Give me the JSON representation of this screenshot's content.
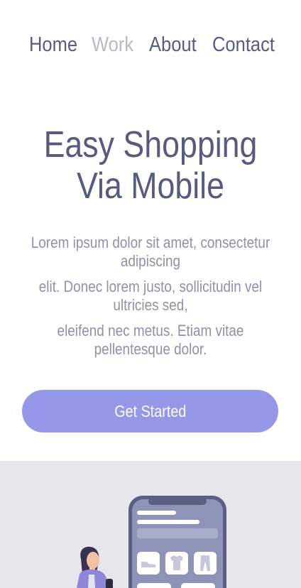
{
  "nav": {
    "items": [
      {
        "label": "Home",
        "active": false
      },
      {
        "label": "Work",
        "active": true
      },
      {
        "label": "About",
        "active": false
      },
      {
        "label": "Contact",
        "active": false
      }
    ]
  },
  "hero": {
    "title_line1": "Easy Shopping",
    "title_line2": "Via Mobile",
    "description_lines": [
      "Lorem ipsum dolor sit amet, consectetur adipiscing",
      "elit. Donec lorem justo, sollicitudin vel ultricies sed,",
      "eleifend nec metus. Etiam vitae pellentesque dolor."
    ],
    "cta_label": "Get Started"
  },
  "illustration": {
    "phone_icons": [
      "shoe-icon",
      "tshirt-icon",
      "pants-icon"
    ]
  },
  "colors": {
    "nav_text": "#585c7e",
    "nav_active": "#b7b8c8",
    "title": "#575b7d",
    "body_text": "#8f91a9",
    "accent": "#9598e9",
    "band_background": "#e7e6ec"
  }
}
